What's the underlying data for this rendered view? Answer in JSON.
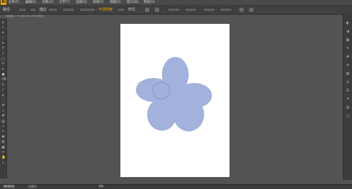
{
  "app": {
    "logo": "Ai",
    "accent": "#f0a000"
  },
  "menubar": {
    "items": [
      "文件(F)",
      "编辑(E)",
      "对象(O)",
      "文字(T)",
      "选择(S)",
      "效果(C)",
      "视图(V)",
      "窗口(W)",
      "帮助(H)"
    ]
  },
  "control_bar": {
    "selection": "路径",
    "stroke_label": "描边",
    "opacity_label": "不透明度",
    "style_label": "样式"
  },
  "document_tab": {
    "title": "未标题-1* @ 66.67% (RGB/预览)"
  },
  "tools": {
    "left": [
      "selection-tool",
      "direct-selection-tool",
      "magic-wand-tool",
      "lasso-tool",
      "pen-tool",
      "type-tool",
      "line-tool",
      "rectangle-tool",
      "paintbrush-tool",
      "pencil-tool",
      "blob-brush-tool",
      "eraser-tool",
      "rotate-tool",
      "scale-tool",
      "width-tool",
      "free-transform-tool",
      "shape-builder-tool",
      "perspective-tool",
      "mesh-tool",
      "gradient-tool",
      "eyedropper-tool",
      "blend-tool",
      "symbol-sprayer-tool",
      "column-graph-tool",
      "artboard-tool",
      "slice-tool",
      "hand-tool",
      "zoom-tool"
    ],
    "right": [
      "color-panel-icon",
      "color-guide-icon",
      "swatches-icon",
      "brushes-icon",
      "symbols-icon",
      "stroke-icon",
      "gradient-icon",
      "transparency-icon",
      "appearance-icon",
      "graphic-styles-icon",
      "layers-icon",
      "artboards-icon"
    ]
  },
  "canvas": {
    "artboard_color": "#ffffff",
    "workspace_color": "#535353",
    "flower_fill": "#a3b1dd"
  },
  "status": {
    "zoom": "66.67%",
    "page": "1",
    "tool": "选择"
  }
}
